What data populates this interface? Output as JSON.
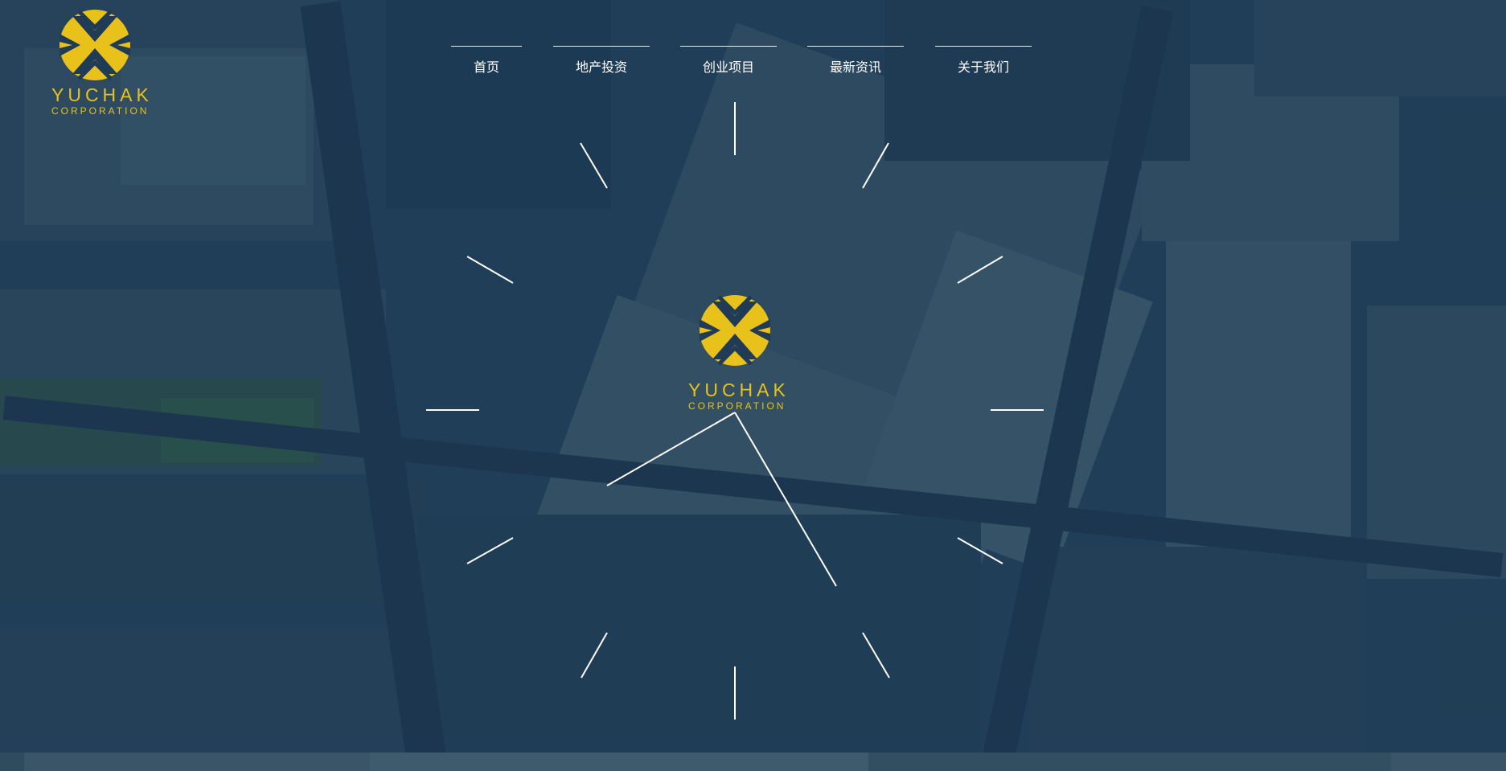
{
  "brand": {
    "name": "YUCHAK",
    "subtitle": "CORPORATION",
    "color": "#e8c21a"
  },
  "nav": {
    "items": [
      {
        "label": "首页"
      },
      {
        "label": "地产投资"
      },
      {
        "label": "创业项目"
      },
      {
        "label": "最新资讯"
      },
      {
        "label": "关于我们"
      }
    ]
  },
  "clock": {
    "hour_hand_points_to": "approx 8 o'clock",
    "minute_hand_points_to": "approx 25 minutes",
    "center_logo": "YUCHAK CORPORATION"
  },
  "colors": {
    "background_tint": "#1c3a55",
    "lines": "#ffffff"
  }
}
